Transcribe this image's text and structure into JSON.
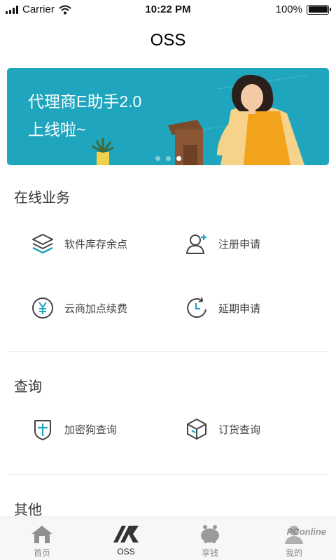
{
  "status_bar": {
    "carrier": "Carrier",
    "time": "10:22 PM",
    "battery": "100%"
  },
  "nav": {
    "title": "OSS"
  },
  "banner": {
    "line1": "代理商E助手2.0",
    "line2": "上线啦~",
    "pages": 3,
    "active_page": 3
  },
  "sections": [
    {
      "title": "在线业务",
      "items": [
        {
          "label": "软件库存余点",
          "icon": "layers-icon"
        },
        {
          "label": "注册申请",
          "icon": "add-user-icon"
        },
        {
          "label": "云商加点续费",
          "icon": "yen-coin-icon"
        },
        {
          "label": "延期申请",
          "icon": "clock-refresh-icon"
        }
      ]
    },
    {
      "title": "查询",
      "items": [
        {
          "label": "加密狗查询",
          "icon": "shield-icon"
        },
        {
          "label": "订货查询",
          "icon": "box-icon"
        }
      ]
    },
    {
      "title": "其他",
      "items": []
    }
  ],
  "tabbar": [
    {
      "label": "首页",
      "icon": "home-icon",
      "active": false
    },
    {
      "label": "OSS",
      "icon": "oss-logo-icon",
      "active": true
    },
    {
      "label": "享钱",
      "icon": "piggy-bank-icon",
      "active": false
    },
    {
      "label": "我的",
      "icon": "user-icon",
      "active": false
    }
  ],
  "watermark": "PConline",
  "colors": {
    "accent": "#1fa5bd",
    "banner_bg": "#1fa5bd",
    "icon_dark": "#444444"
  }
}
